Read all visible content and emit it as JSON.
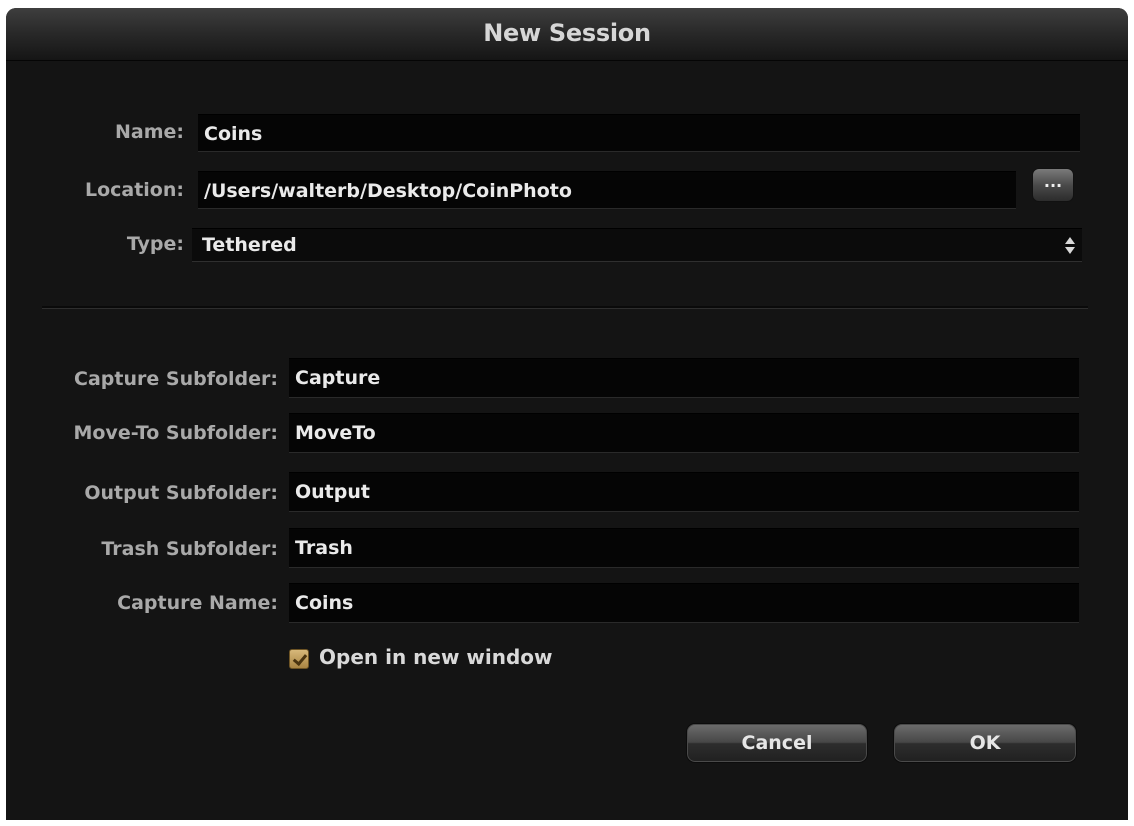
{
  "window": {
    "title": "New Session"
  },
  "form": {
    "name_label": "Name:",
    "name_value": "Coins",
    "location_label": "Location:",
    "location_value": "/Users/walterb/Desktop/CoinPhoto",
    "browse_label": "...",
    "type_label": "Type:",
    "type_value": "Tethered",
    "capture_subfolder_label": "Capture Subfolder:",
    "capture_subfolder_value": "Capture",
    "moveto_subfolder_label": "Move-To Subfolder:",
    "moveto_subfolder_value": "MoveTo",
    "output_subfolder_label": "Output Subfolder:",
    "output_subfolder_value": "Output",
    "trash_subfolder_label": "Trash Subfolder:",
    "trash_subfolder_value": "Trash",
    "capture_name_label": "Capture Name:",
    "capture_name_value": "Coins",
    "open_new_window_label": "Open in new window",
    "open_new_window_checked": true
  },
  "buttons": {
    "cancel": "Cancel",
    "ok": "OK"
  },
  "colors": {
    "background": "#141414",
    "field_background": "#050505",
    "checkbox_accent": "#c9a55f"
  }
}
